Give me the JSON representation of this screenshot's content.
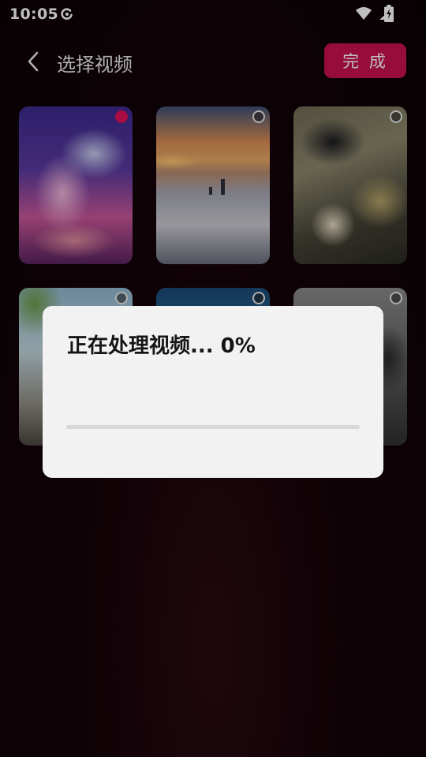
{
  "status_bar": {
    "time": "10:05",
    "icons": [
      "c-app-icon",
      "wifi-icon",
      "signal-icon",
      "battery-charging-icon"
    ]
  },
  "header": {
    "back_icon": "chevron-left-icon",
    "title": "选择视频",
    "done_label": "完 成"
  },
  "colors": {
    "accent": "#c8104e",
    "selected_radio": "#e0105a",
    "dialog_bg": "#f2f2f2"
  },
  "videos": [
    {
      "selected": true
    },
    {
      "selected": false
    },
    {
      "selected": false
    },
    {
      "selected": false
    },
    {
      "selected": false
    },
    {
      "selected": false
    }
  ],
  "dialog": {
    "message": "正在处理视频... 0%",
    "progress": 0
  }
}
